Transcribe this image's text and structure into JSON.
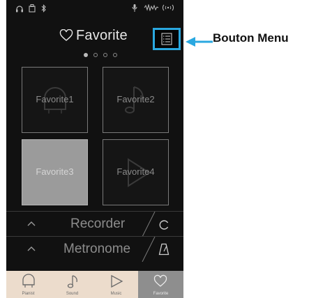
{
  "header": {
    "title": "Favorite"
  },
  "pager": {
    "pages": 4,
    "active_index": 0
  },
  "favorites": [
    {
      "label": "Favorite1",
      "icon": "piano-icon",
      "selected": false
    },
    {
      "label": "Favorite2",
      "icon": "music-note-icon",
      "selected": false
    },
    {
      "label": "Favorite3",
      "icon": "",
      "selected": true
    },
    {
      "label": "Favorite4",
      "icon": "play-icon",
      "selected": false
    }
  ],
  "panels": {
    "recorder": {
      "label": "Recorder",
      "icon": "recorder-circle-icon"
    },
    "metronome": {
      "label": "Metronome",
      "icon": "metronome-icon"
    }
  },
  "bottom_nav": [
    {
      "label": "Pianist",
      "icon": "piano-icon",
      "active": false
    },
    {
      "label": "Sound",
      "icon": "music-note-icon",
      "active": false
    },
    {
      "label": "Music",
      "icon": "play-icon",
      "active": false
    },
    {
      "label": "Favorite",
      "icon": "heart-icon",
      "active": true
    }
  ],
  "status_icons": [
    "headphones-icon",
    "usb-icon",
    "bluetooth-icon",
    "microphone-icon",
    "audio-wave-icon",
    "wireless-icon"
  ],
  "annotation": {
    "label": "Bouton Menu",
    "color": "#2aa8e0"
  },
  "colors": {
    "accent": "#2aa8e0",
    "background": "#111111",
    "nav_background": "#ecdccc"
  }
}
